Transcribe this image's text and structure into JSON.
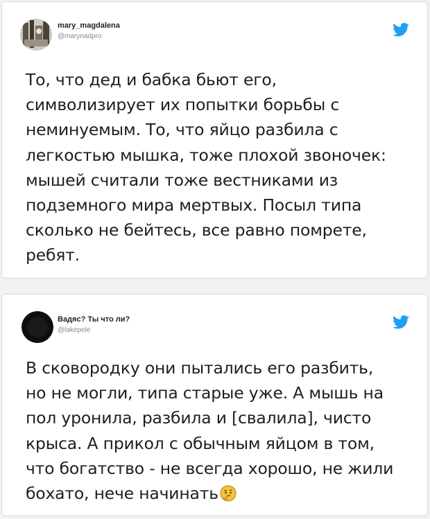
{
  "tweets": [
    {
      "author_name": "mary_magdalena",
      "author_handle": "@marynadpro",
      "text": "То, что дед и бабка бьют его,\nсимволизирует их попытки борьбы с\nнеминуемым. То, что яйцо разбила с\nлегкостью мышка, тоже плохой звоночек:\nмышей считали тоже вестниками из\nподземного мира мертвых. Посыл типа\nсколько не бейтесь, все равно помрете,\nребят."
    },
    {
      "author_name": "Вадяс? Ты что ли?",
      "author_handle": "@lakepele",
      "text": "В сковородку они пытались его разбить,\nно не могли, типа старые уже. А мышь на\nпол уронила, разбила и [свалила], чисто\nкрыса. А прикол с обычным яйцом в том,\nчто богатство - не всегда хорошо, не жили\nбохато, нече начинать",
      "emoji": "thinking-face-icon"
    }
  ],
  "colors": {
    "twitter_blue": "#1da1f2",
    "card_bg": "#ffffff",
    "page_bg": "#f2f2f2",
    "handle_gray": "#8a8a8a"
  }
}
